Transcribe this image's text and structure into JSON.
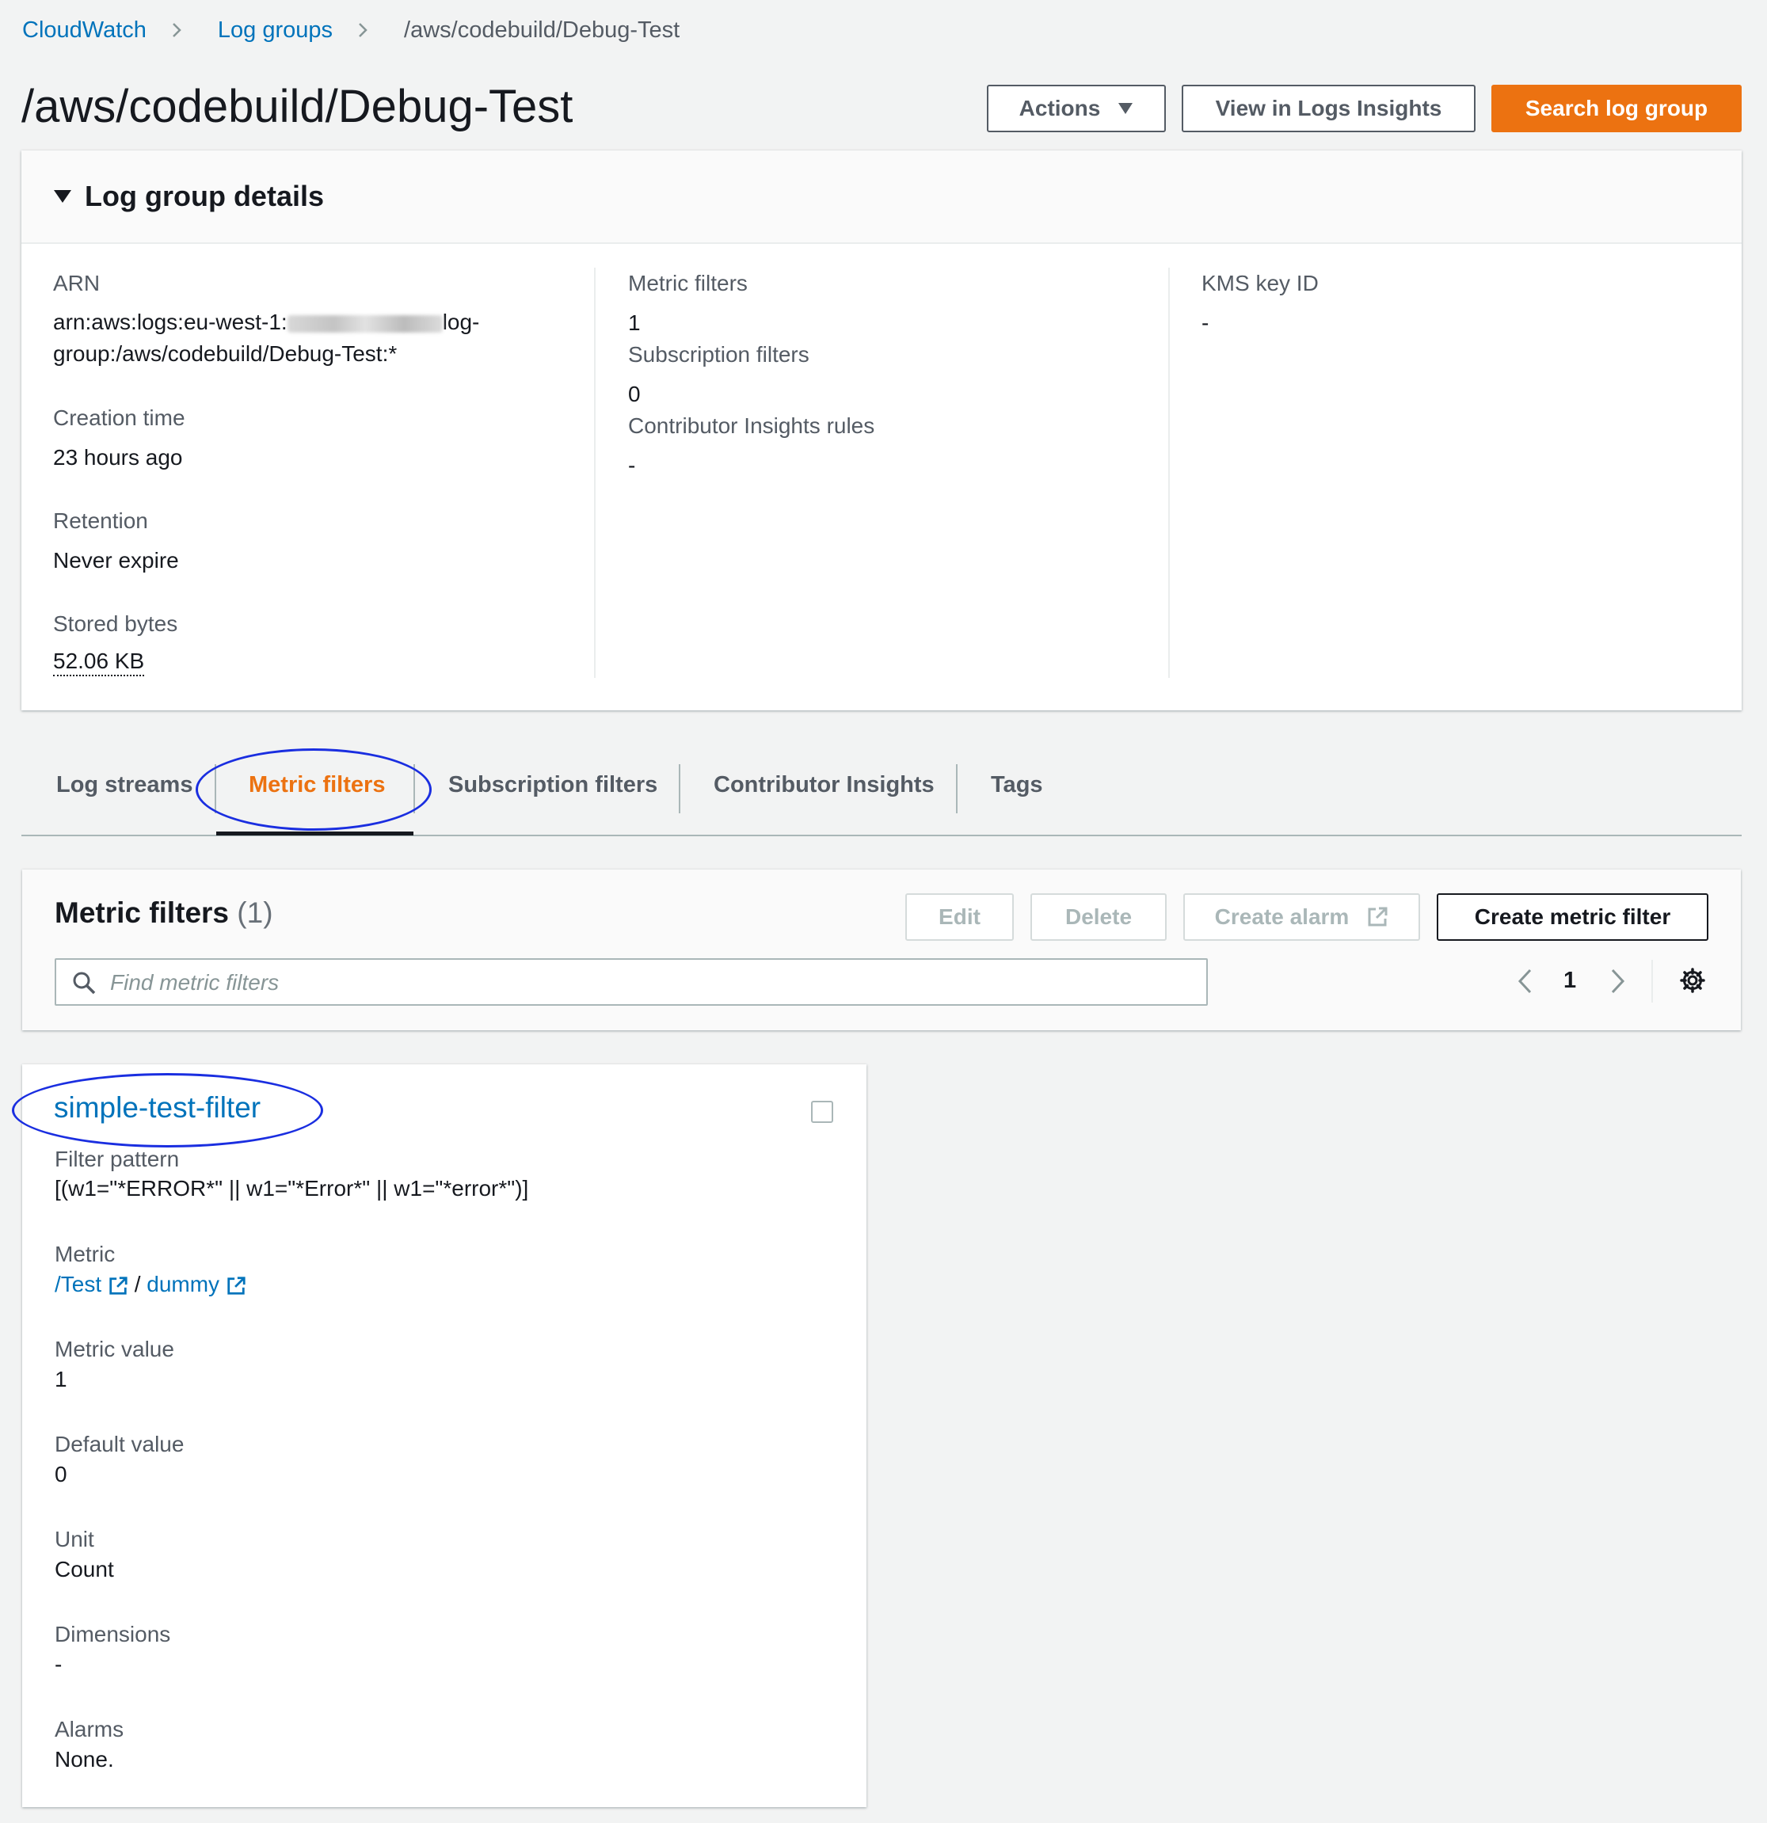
{
  "breadcrumb": {
    "items": [
      "CloudWatch",
      "Log groups"
    ],
    "current": "/aws/codebuild/Debug-Test"
  },
  "page": {
    "title": "/aws/codebuild/Debug-Test",
    "actions_label": "Actions",
    "logs_insights_label": "View in Logs Insights",
    "search_log_group_label": "Search log group"
  },
  "details": {
    "title": "Log group details",
    "arn_label": "ARN",
    "arn_prefix": "arn:aws:logs:eu-west-1:",
    "arn_suffix_1": "log-",
    "arn_suffix_2": "group:/aws/codebuild/Debug-Test:*",
    "creation_time_label": "Creation time",
    "creation_time": "23 hours ago",
    "retention_label": "Retention",
    "retention": "Never expire",
    "stored_bytes_label": "Stored bytes",
    "stored_bytes": "52.06 KB",
    "metric_filters_label": "Metric filters",
    "metric_filters": "1",
    "subscription_filters_label": "Subscription filters",
    "subscription_filters": "0",
    "contributor_rules_label": "Contributor Insights rules",
    "contributor_rules": "-",
    "kms_label": "KMS key ID",
    "kms": "-"
  },
  "tabs": [
    {
      "label": "Log streams",
      "active": false
    },
    {
      "label": "Metric filters",
      "active": true
    },
    {
      "label": "Subscription filters",
      "active": false
    },
    {
      "label": "Contributor Insights",
      "active": false
    },
    {
      "label": "Tags",
      "active": false
    }
  ],
  "metric_filters_panel": {
    "title": "Metric filters",
    "count": "(1)",
    "edit_label": "Edit",
    "delete_label": "Delete",
    "create_alarm_label": "Create alarm",
    "create_metric_filter_label": "Create metric filter",
    "search_placeholder": "Find metric filters",
    "current_page": "1"
  },
  "filter_card": {
    "name": "simple-test-filter",
    "filter_pattern_label": "Filter pattern",
    "filter_pattern": "[(w1=\"*ERROR*\" || w1=\"*Error*\" || w1=\"*error*\")]",
    "metric_label": "Metric",
    "metric_namespace": "/Test",
    "metric_separator": "/",
    "metric_name": "dummy",
    "metric_value_label": "Metric value",
    "metric_value": "1",
    "default_value_label": "Default value",
    "default_value": "0",
    "unit_label": "Unit",
    "unit": "Count",
    "dimensions_label": "Dimensions",
    "dimensions": "-",
    "alarms_label": "Alarms",
    "alarms": "None."
  },
  "colors": {
    "primary_orange": "#ec7211",
    "link_blue": "#0073bb",
    "annotation_blue": "#1a2ee0",
    "background": "#f2f3f3"
  },
  "icons": [
    "chevron-right-icon",
    "caret-down-icon",
    "triangle-down-icon",
    "search-icon",
    "chevron-left-icon",
    "gear-icon",
    "external-link-icon"
  ]
}
